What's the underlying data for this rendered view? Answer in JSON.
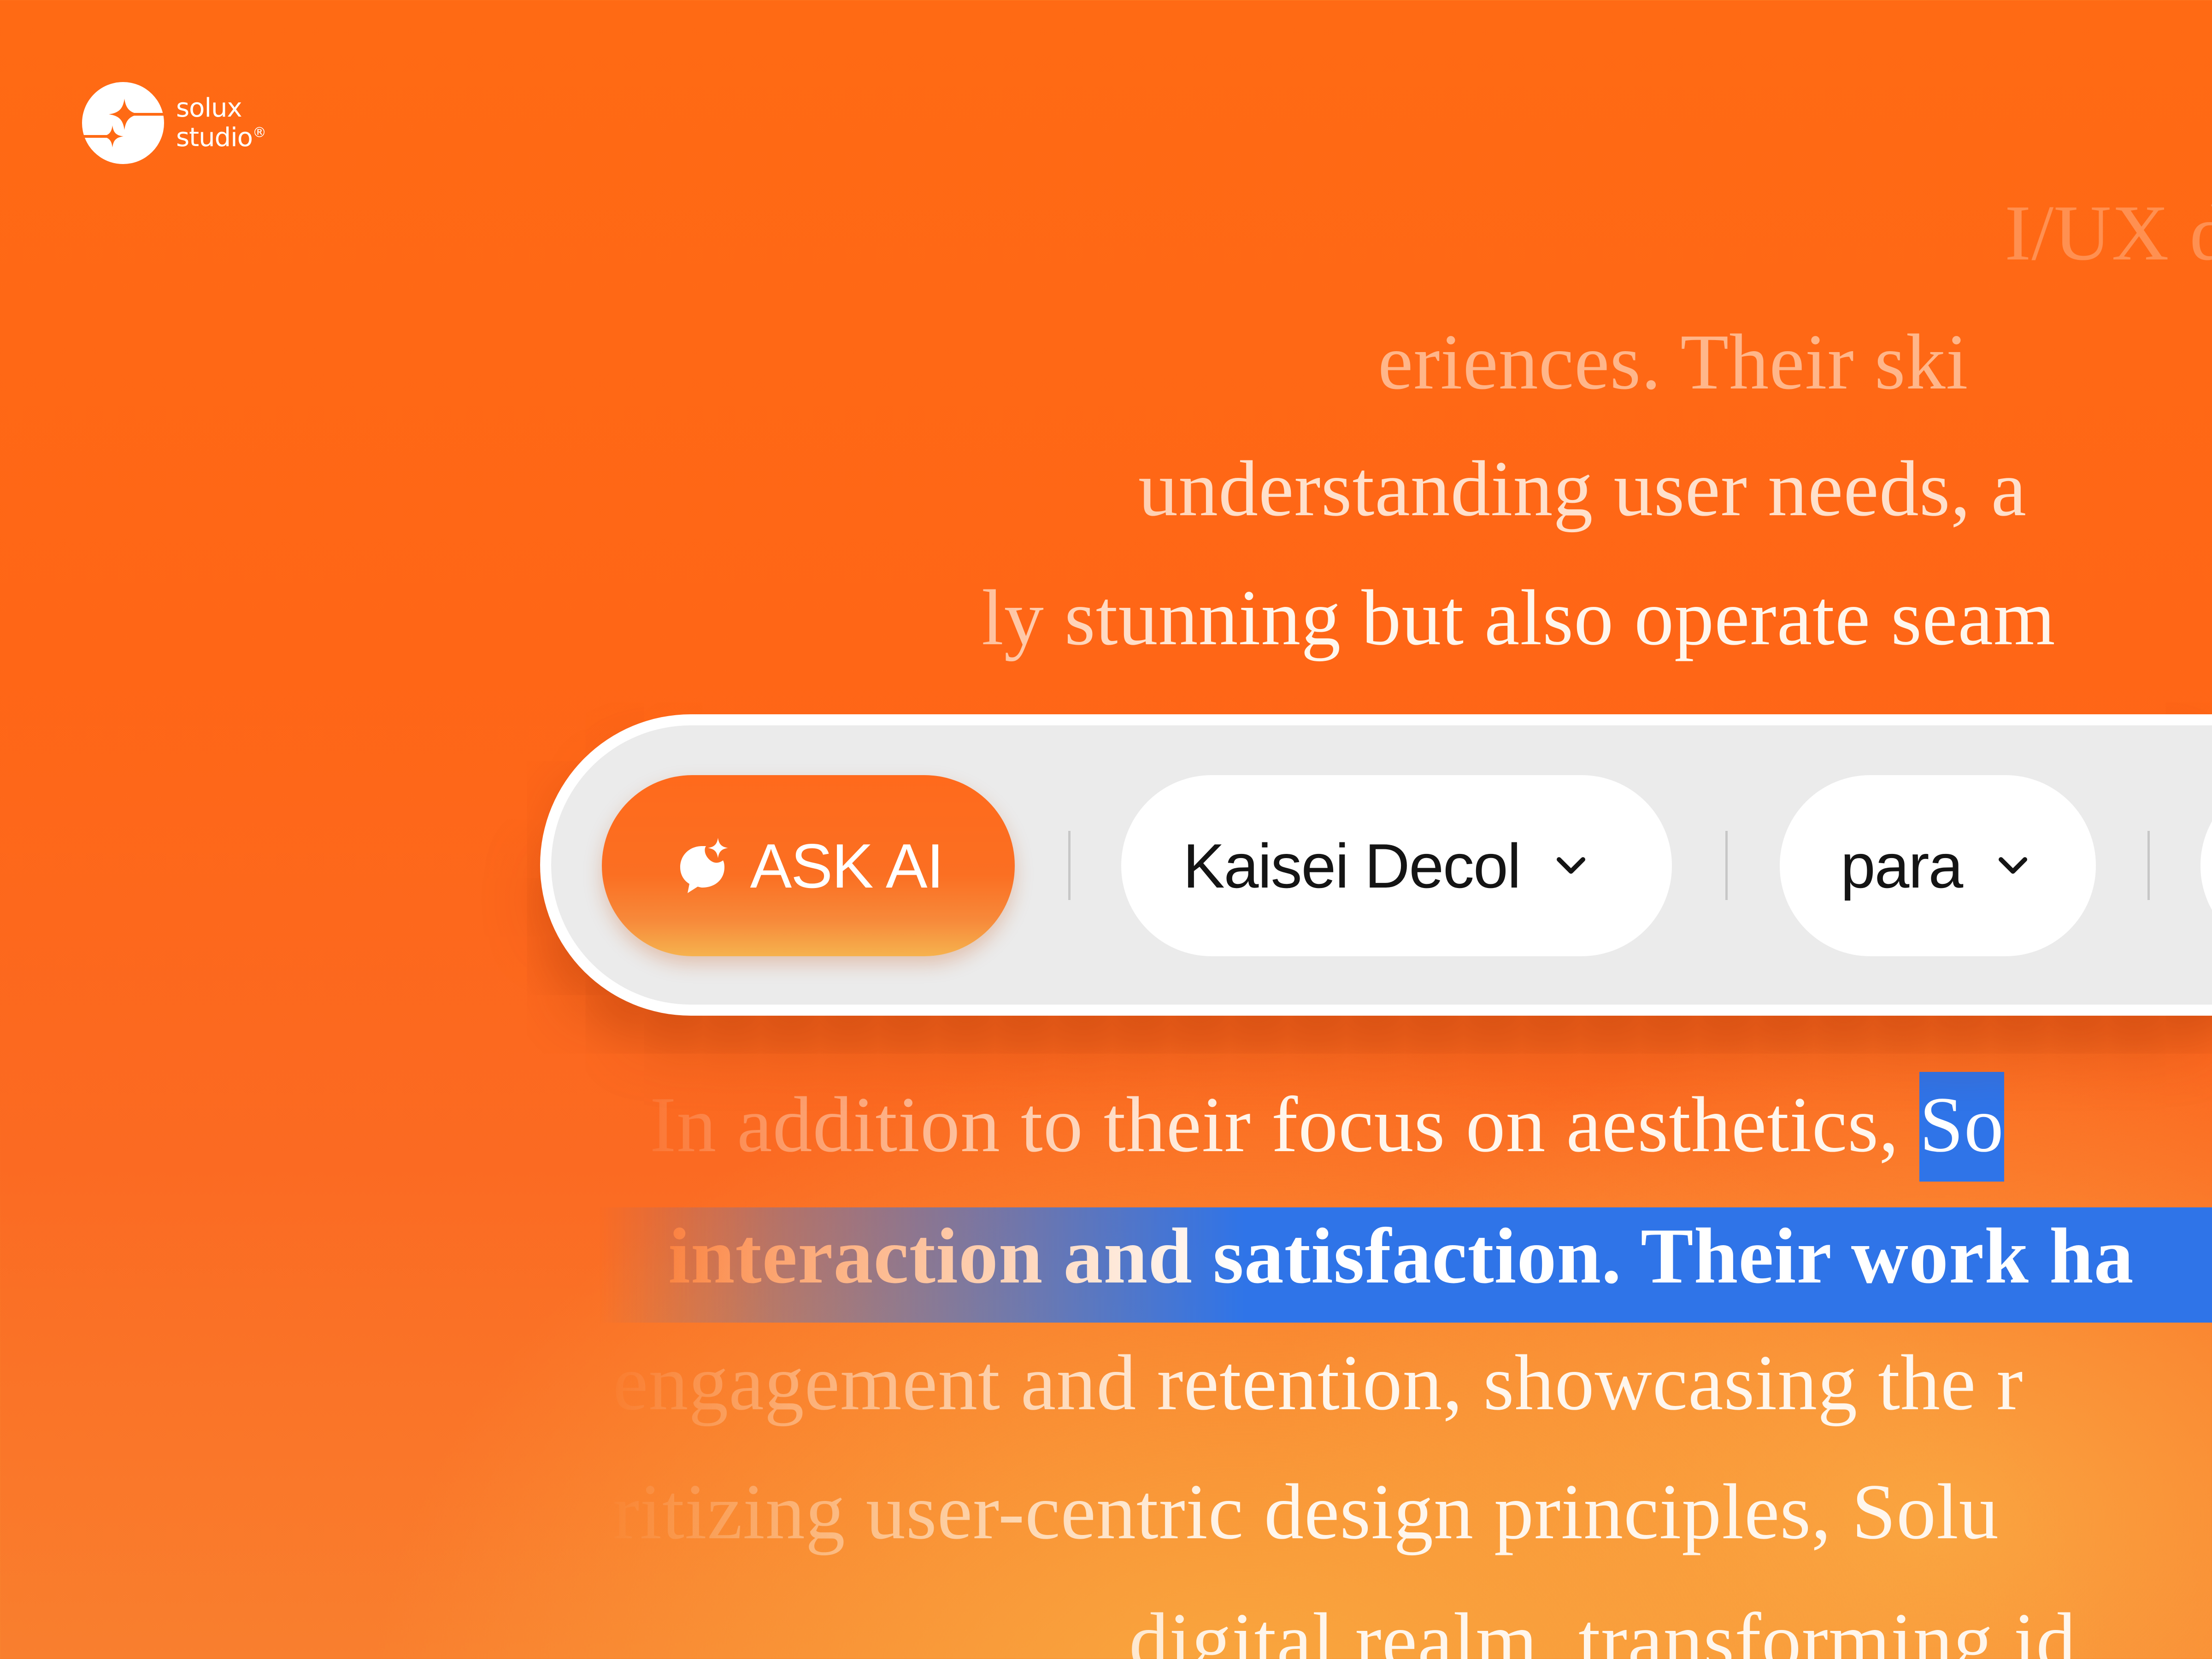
{
  "brand": {
    "line1": "solux",
    "line2": "studio",
    "reg": "®"
  },
  "toolbar": {
    "ask_ai_label": "ASK AI",
    "font_select_value": "Kaisei Decol",
    "style_select_value": "para"
  },
  "body_text": {
    "line1": "I/UX d",
    "line2": "eriences. Their ski",
    "line3": "understanding user needs, a",
    "line4": "ly stunning but also operate seam",
    "line5_before": "In addition to their focus on aesthetics, ",
    "line5_selected": "So",
    "line6_selected": "interaction and satisfaction. Their work ha",
    "line7": "engagement and retention, showcasing the r",
    "line8": "ritizing user-centric design principles, Solu",
    "line9": "digital realm, transforming id"
  },
  "colors": {
    "background_orange": "#ff6a14",
    "background_amber": "#f9aa40",
    "selection_blue": "#2f74e8",
    "toolbar_gray": "#ebebeb",
    "text_dark": "#141414"
  },
  "icons": {
    "brand": "sparkle-logo-icon",
    "ask_ai": "ai-chat-sparkle-icon",
    "dropdown": "chevron-down-icon"
  }
}
